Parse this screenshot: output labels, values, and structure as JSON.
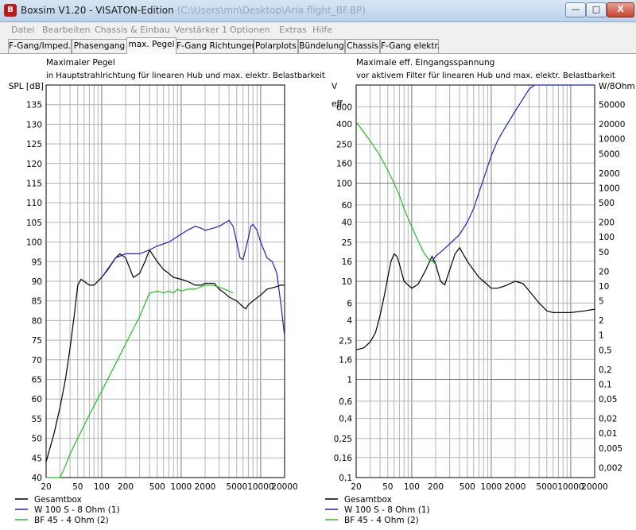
{
  "window": {
    "app_title": "Boxsim V1.20 - VISATON-Edition",
    "path": "(C:\\Users\\mn\\Desktop\\Aria flight_BF.BP)",
    "minimize": "—",
    "maximize": "□",
    "close": "X"
  },
  "menu": [
    "Datei",
    "Bearbeiten",
    "Chassis & Einbau",
    "Verstärker 1",
    "Optionen",
    "Extras",
    "Hilfe"
  ],
  "tabs": [
    "F-Gang/Imped.",
    "Phasengang",
    "max. Pegel",
    "F-Gang Richtungen",
    "Polarplots",
    "Bündelung",
    "Chassis",
    "F-Gang elektr."
  ],
  "active_tab": 2,
  "colors": {
    "gesamt": "#000000",
    "woofer": "#2020c0",
    "tweeter": "#20c020",
    "grid": "#b4b4b4",
    "grid_major": "#7a7a7a"
  },
  "legend": [
    {
      "label": "Gesamtbox",
      "color": "#000000"
    },
    {
      "label": "W 100 S - 8 Ohm (1)",
      "color": "#2020c0"
    },
    {
      "label": "BF 45 - 4 Ohm (2)",
      "color": "#20c020"
    }
  ],
  "chart_data": [
    {
      "type": "line",
      "title": "Maximaler Pegel",
      "subtitle": "in Hauptstrahlrichtung für linearen Hub und max. elektr. Belastbarkeit",
      "ylabel": "SPL [dB]",
      "xscale": "log",
      "xlim": [
        20,
        20000
      ],
      "ylim": [
        40,
        140
      ],
      "x_ticks": [
        "20",
        "50",
        "100",
        "200",
        "500",
        "1000",
        "2000",
        "5000",
        "10000",
        "20000"
      ],
      "y_ticks": [
        "40",
        "45",
        "50",
        "55",
        "60",
        "65",
        "70",
        "75",
        "80",
        "85",
        "90",
        "95",
        "100",
        "105",
        "110",
        "115",
        "120",
        "125",
        "130",
        "135"
      ],
      "series": [
        {
          "name": "Gesamtbox",
          "x": [
            20,
            25,
            30,
            35,
            40,
            45,
            50,
            55,
            60,
            70,
            80,
            100,
            120,
            150,
            170,
            200,
            250,
            300,
            350,
            400,
            500,
            600,
            700,
            800,
            1000,
            1200,
            1500,
            1800,
            2000,
            2300,
            2600,
            3000,
            3500,
            4000,
            5000,
            6000,
            6500,
            7000,
            8000,
            10000,
            12000,
            15000,
            18000,
            20000
          ],
          "y": [
            44,
            51,
            58,
            65,
            73,
            81,
            89,
            90.5,
            90,
            89,
            89,
            91,
            93,
            96,
            97,
            96,
            91,
            92,
            95,
            98,
            95,
            93,
            92,
            91,
            90.5,
            90,
            89,
            89,
            89.5,
            89.5,
            89.5,
            88,
            87,
            86,
            85,
            83.5,
            83,
            84,
            85,
            86.5,
            88,
            88.5,
            89,
            89
          ]
        },
        {
          "name": "W 100 S - 8 Ohm (1)",
          "x": [
            100,
            150,
            200,
            300,
            400,
            500,
            700,
            1000,
            1200,
            1500,
            1800,
            2000,
            2500,
            3000,
            4000,
            4500,
            5000,
            5500,
            6000,
            7000,
            7500,
            8000,
            9000,
            10000,
            12000,
            14000,
            16000,
            18000,
            20000
          ],
          "y": [
            91,
            96,
            97,
            97,
            98,
            99,
            100,
            102,
            103,
            104,
            103.5,
            103,
            103.5,
            104,
            105.5,
            104,
            100,
            96,
            95.5,
            101,
            104,
            104.5,
            103,
            100,
            96,
            95,
            92,
            84,
            76
          ]
        },
        {
          "name": "BF 45 - 4 Ohm (2)",
          "x": [
            20,
            30,
            35,
            40,
            50,
            70,
            100,
            150,
            200,
            300,
            400,
            500,
            600,
            700,
            800,
            900,
            1000,
            1200,
            1500,
            2000,
            2500,
            3000,
            3500,
            4000,
            4500
          ],
          "y": [
            40,
            40,
            43,
            46,
            50,
            56,
            62,
            69,
            74,
            81,
            87,
            87.5,
            87,
            87.5,
            87,
            88,
            87.5,
            88,
            88,
            89,
            89,
            88.5,
            88,
            87.5,
            87
          ]
        }
      ]
    },
    {
      "type": "line",
      "title": "Maximale eff. Eingangsspannung",
      "subtitle": "vor aktivem Filter für linearen Hub und max. elektr. Belastbarkeit",
      "ylabel": "V eff",
      "y2label": "W/8Ohm",
      "xscale": "log",
      "yscale": "log",
      "xlim": [
        20,
        20000
      ],
      "ylim": [
        0.1,
        1000
      ],
      "x_ticks": [
        "20",
        "50",
        "100",
        "200",
        "500",
        "1000",
        "2000",
        "5000",
        "10000",
        "20000"
      ],
      "y_ticks": [
        "0,1",
        "0,16",
        "0,25",
        "0,4",
        "0,6",
        "1",
        "1,6",
        "2,5",
        "4",
        "6",
        "10",
        "16",
        "25",
        "40",
        "60",
        "100",
        "160",
        "250",
        "400",
        "600"
      ],
      "y2_ticks": [
        "0,002",
        "0,005",
        "0,01",
        "0,02",
        "0,05",
        "0,1",
        "0,2",
        "0,5",
        "1",
        "2",
        "5",
        "10",
        "20",
        "50",
        "100",
        "200",
        "500",
        "1000",
        "2000",
        "5000",
        "10000",
        "20000",
        "50000"
      ],
      "series": [
        {
          "name": "Gesamtbox",
          "x": [
            20,
            25,
            30,
            35,
            40,
            45,
            50,
            55,
            60,
            65,
            70,
            80,
            100,
            120,
            150,
            180,
            200,
            230,
            260,
            300,
            350,
            400,
            500,
            600,
            700,
            800,
            1000,
            1200,
            1500,
            2000,
            2500,
            3000,
            4000,
            5000,
            6000,
            8000,
            10000,
            15000,
            20000
          ],
          "y": [
            2,
            2.1,
            2.4,
            3,
            4.5,
            7,
            11,
            16,
            19,
            18,
            15,
            10,
            8.5,
            9.3,
            13,
            18,
            15,
            10,
            9.2,
            13,
            19,
            22,
            16,
            13,
            11,
            10,
            8.5,
            8.5,
            9,
            10,
            9.5,
            8,
            6,
            5,
            4.8,
            4.8,
            4.8,
            5,
            5.2
          ]
        },
        {
          "name": "W 100 S - 8 Ohm (1)",
          "x": [
            180,
            200,
            250,
            300,
            400,
            500,
            600,
            700,
            800,
            1000,
            1200,
            1500,
            2000,
            2500,
            3000,
            3500,
            4000,
            20000
          ],
          "y": [
            16,
            18,
            21,
            24,
            30,
            40,
            55,
            80,
            110,
            190,
            270,
            370,
            540,
            720,
            910,
            1000,
            1000,
            1000
          ]
        },
        {
          "name": "BF 45 - 4 Ohm (2)",
          "x": [
            20,
            25,
            30,
            40,
            50,
            60,
            70,
            80,
            100,
            120,
            140,
            160,
            180,
            200
          ],
          "y": [
            420,
            330,
            270,
            190,
            135,
            100,
            75,
            55,
            36,
            26,
            20,
            17,
            16,
            15
          ]
        }
      ]
    }
  ]
}
